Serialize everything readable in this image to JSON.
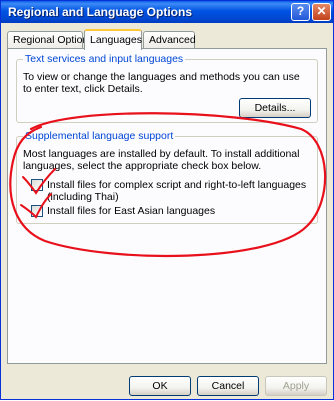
{
  "window": {
    "title": "Regional and Language Options",
    "help_glyph": "?",
    "close_glyph": "✕"
  },
  "tabs": [
    {
      "label": "Regional Options",
      "active": false
    },
    {
      "label": "Languages",
      "active": true
    },
    {
      "label": "Advanced",
      "active": false
    }
  ],
  "text_services": {
    "heading": "Text services and input languages",
    "description": "To view or change the languages and methods you can use to enter text, click Details.",
    "details_button": "Details..."
  },
  "supplemental": {
    "heading": "Supplemental language support",
    "description": "Most languages are installed by default. To install additional languages, select the appropriate check box below.",
    "complex_script_label": "Install files for complex script and right-to-left languages (including Thai)",
    "east_asian_label": "Install files for East Asian languages"
  },
  "footer": {
    "ok": "OK",
    "cancel": "Cancel",
    "apply": "Apply"
  },
  "colors": {
    "titlebar": "#0054e3",
    "group_heading": "#0046d5",
    "annotation": "#e8101a"
  }
}
